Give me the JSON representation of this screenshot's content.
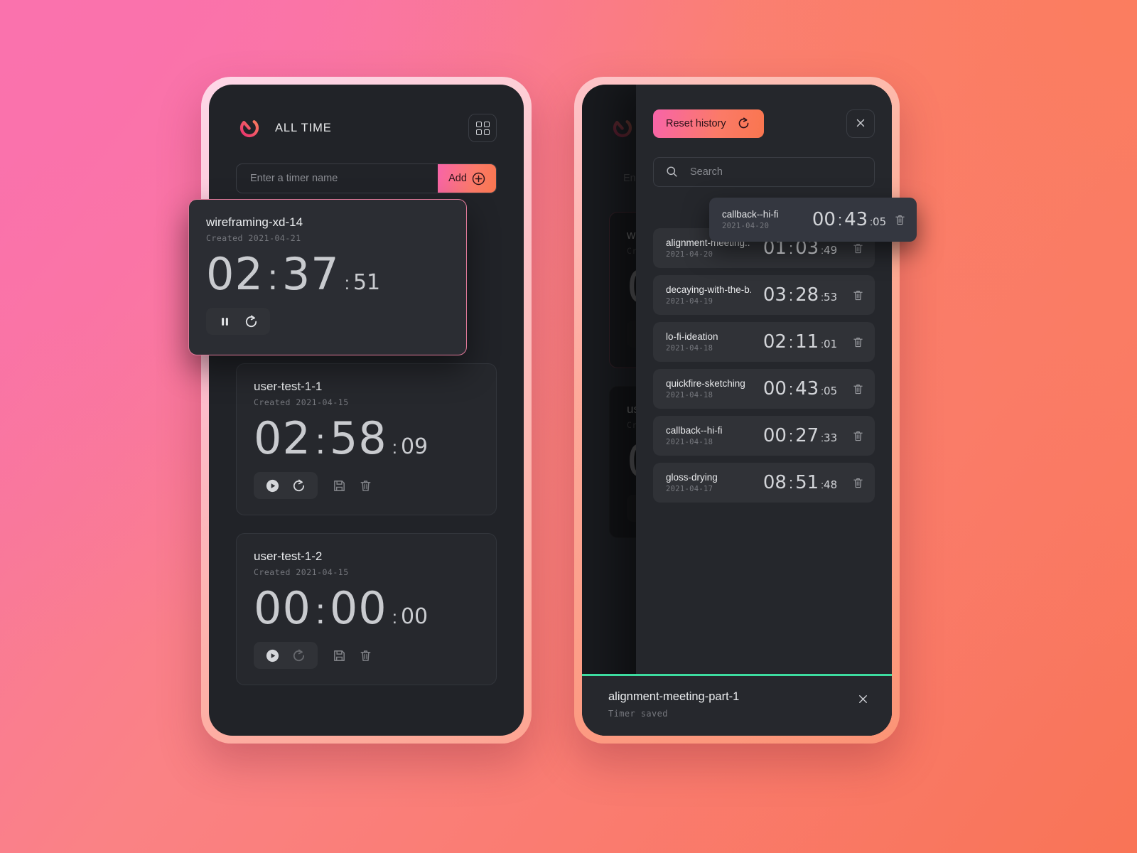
{
  "app": {
    "title": "ALL TIME",
    "logo_icon": "loop-timer-logo-icon",
    "grid_icon": "grid-view-icon",
    "accent_start": "#f864a9",
    "accent_end": "#f9764f",
    "screen_bg": "#212328",
    "toast_accent": "#3ddca0"
  },
  "add_row": {
    "placeholder": "Enter a timer name",
    "value": "",
    "button_label": "Add",
    "button_icon": "plus-circle-icon"
  },
  "timers": [
    {
      "name": "wireframing-xd-14",
      "created": "Created 2021-04-21",
      "minutes": "02",
      "seconds": "37",
      "hundredths": "51",
      "running": true,
      "selected": true,
      "controls": [
        "pause-icon",
        "reset-icon"
      ]
    },
    {
      "name": "user-test-1-1",
      "created": "Created 2021-04-15",
      "minutes": "02",
      "seconds": "58",
      "hundredths": "09",
      "running": false,
      "selected": false,
      "controls": [
        "play-icon",
        "reset-icon",
        "save-icon",
        "delete-icon"
      ]
    },
    {
      "name": "user-test-1-2",
      "created": "Created 2021-04-15",
      "minutes": "00",
      "seconds": "00",
      "hundredths": "00",
      "running": false,
      "selected": false,
      "controls": [
        "play-icon",
        "reset-icon-disabled",
        "save-icon",
        "delete-icon"
      ]
    }
  ],
  "drawer": {
    "reset_label": "Reset history",
    "reset_icon": "reset-icon",
    "close_icon": "close-icon",
    "search_placeholder": "Search",
    "search_value": "",
    "search_icon": "search-icon",
    "delete_icon": "delete-icon",
    "dragging_entry": {
      "name": "callback--hi-fi",
      "date": "2021-04-20",
      "minutes": "00",
      "seconds": "43",
      "hundredths": "05"
    },
    "entries": [
      {
        "name": "alignment-meeting..",
        "date": "2021-04-20",
        "minutes": "01",
        "seconds": "03",
        "hundredths": "49"
      },
      {
        "name": "decaying-with-the-b..",
        "date": "2021-04-19",
        "minutes": "03",
        "seconds": "28",
        "hundredths": "53"
      },
      {
        "name": "lo-fi-ideation",
        "date": "2021-04-18",
        "minutes": "02",
        "seconds": "11",
        "hundredths": "01"
      },
      {
        "name": "quickfire-sketching",
        "date": "2021-04-18",
        "minutes": "00",
        "seconds": "43",
        "hundredths": "05"
      },
      {
        "name": "callback--hi-fi",
        "date": "2021-04-18",
        "minutes": "00",
        "seconds": "27",
        "hundredths": "33"
      },
      {
        "name": "gloss-drying",
        "date": "2021-04-17",
        "minutes": "08",
        "seconds": "51",
        "hundredths": "48"
      }
    ]
  },
  "toast": {
    "title": "alignment-meeting-part-1",
    "subtitle": "Timer saved",
    "close_icon": "close-icon"
  },
  "separators": {
    "colon": ":"
  }
}
